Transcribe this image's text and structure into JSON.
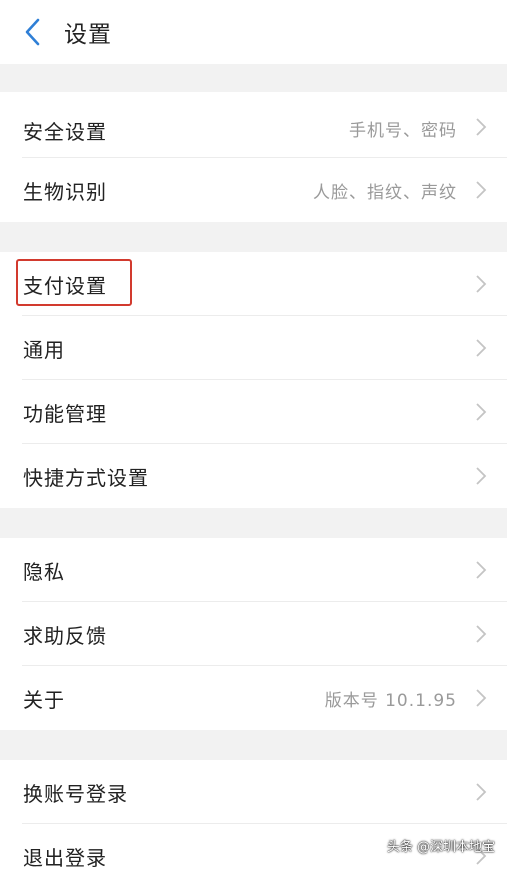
{
  "header": {
    "title": "设置"
  },
  "groups": [
    [
      {
        "label": "安全设置",
        "value": "手机号、密码"
      },
      {
        "label": "生物识别",
        "value": "人脸、指纹、声纹"
      }
    ],
    [
      {
        "label": "支付设置",
        "value": ""
      },
      {
        "label": "通用",
        "value": ""
      },
      {
        "label": "功能管理",
        "value": ""
      },
      {
        "label": "快捷方式设置",
        "value": ""
      }
    ],
    [
      {
        "label": "隐私",
        "value": ""
      },
      {
        "label": "求助反馈",
        "value": ""
      },
      {
        "label": "关于",
        "value": "版本号 10.1.95"
      }
    ],
    [
      {
        "label": "换账号登录",
        "value": ""
      },
      {
        "label": "退出登录",
        "value": ""
      }
    ]
  ],
  "watermark": "头条 @深圳本地宝",
  "colors": {
    "accent": "#2f7fd6",
    "highlight": "#d23a2e"
  }
}
